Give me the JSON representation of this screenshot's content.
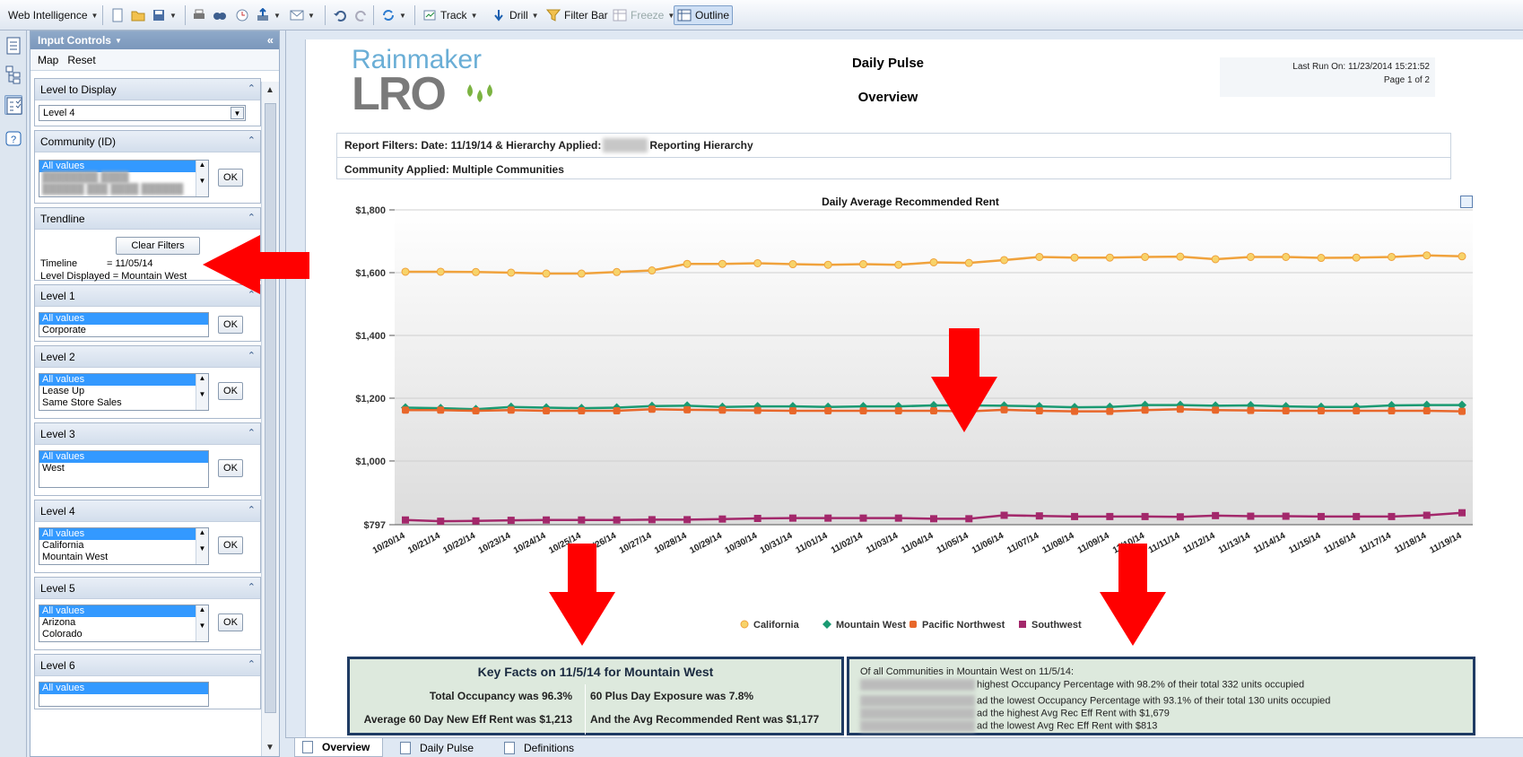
{
  "toolbar": {
    "app_menu": "Web Intelligence",
    "track": "Track",
    "drill": "Drill",
    "filter_bar": "Filter Bar",
    "freeze": "Freeze",
    "outline": "Outline"
  },
  "panel": {
    "title": "Input Controls",
    "map": "Map",
    "reset": "Reset",
    "level_to_display": {
      "title": "Level to Display",
      "value": "Level 4"
    },
    "community": {
      "title": "Community (ID)",
      "items": [
        "All values"
      ],
      "ok": "OK"
    },
    "trendline": {
      "title": "Trendline",
      "clear": "Clear Filters",
      "timeline_label": "Timeline",
      "timeline_value": "= 11/05/14",
      "level_displayed": "Level Displayed = Mountain West"
    },
    "level1": {
      "title": "Level 1",
      "items": [
        "All values",
        "Corporate"
      ],
      "ok": "OK"
    },
    "level2": {
      "title": "Level 2",
      "items": [
        "All values",
        "Lease Up",
        "Same Store Sales"
      ],
      "ok": "OK"
    },
    "level3": {
      "title": "Level 3",
      "items": [
        "All values",
        "West"
      ],
      "ok": "OK"
    },
    "level4": {
      "title": "Level 4",
      "items": [
        "All values",
        "California",
        "Mountain West"
      ],
      "ok": "OK"
    },
    "level5": {
      "title": "Level 5",
      "items": [
        "All values",
        "Arizona",
        "Colorado"
      ],
      "ok": "OK"
    },
    "level6": {
      "title": "Level 6",
      "items": [
        "All values"
      ]
    }
  },
  "report": {
    "logo_top": "Rainmaker",
    "logo_bottom": "LRO",
    "title": "Daily Pulse",
    "subtitle": "Overview",
    "last_run": "Last Run On: 11/23/2014 15:21:52",
    "page": "Page 1 of 2",
    "filter_prefix": "Report Filters: Date: 11/19/14 & Hierarchy Applied:",
    "filter_suffix": "Reporting Hierarchy",
    "community_applied": "Community Applied: Multiple Communities"
  },
  "chart_data": {
    "type": "line",
    "title": "Daily Average Recommended Rent",
    "categories": [
      "10/20/14",
      "10/21/14",
      "10/22/14",
      "10/23/14",
      "10/24/14",
      "10/25/14",
      "10/26/14",
      "10/27/14",
      "10/28/14",
      "10/29/14",
      "10/30/14",
      "10/31/14",
      "11/01/14",
      "11/02/14",
      "11/03/14",
      "11/04/14",
      "11/05/14",
      "11/06/14",
      "11/07/14",
      "11/08/14",
      "11/09/14",
      "11/10/14",
      "11/11/14",
      "11/12/14",
      "11/13/14",
      "11/14/14",
      "11/15/14",
      "11/16/14",
      "11/17/14",
      "11/18/14",
      "11/19/14"
    ],
    "y_ticks": [
      "$1,800",
      "$1,600",
      "$1,400",
      "$1,200",
      "$1,000",
      "$797"
    ],
    "ylim": [
      797,
      1800
    ],
    "series": [
      {
        "name": "California",
        "color": "#f0a23c",
        "marker": "circle",
        "values": [
          1603,
          1603,
          1602,
          1600,
          1597,
          1597,
          1602,
          1607,
          1628,
          1628,
          1630,
          1627,
          1625,
          1627,
          1625,
          1633,
          1631,
          1640,
          1650,
          1648,
          1648,
          1650,
          1651,
          1643,
          1650,
          1650,
          1647,
          1648,
          1650,
          1655,
          1652
        ]
      },
      {
        "name": "Mountain West",
        "color": "#1a9a72",
        "marker": "diamond",
        "values": [
          1170,
          1168,
          1165,
          1172,
          1170,
          1168,
          1170,
          1175,
          1176,
          1172,
          1174,
          1174,
          1172,
          1174,
          1174,
          1177,
          1177,
          1176,
          1174,
          1171,
          1172,
          1178,
          1178,
          1176,
          1177,
          1174,
          1172,
          1172,
          1177,
          1178,
          1178
        ]
      },
      {
        "name": "Pacific Northwest",
        "color": "#e8672a",
        "marker": "square-round",
        "values": [
          1162,
          1162,
          1160,
          1162,
          1160,
          1160,
          1160,
          1165,
          1163,
          1162,
          1161,
          1160,
          1160,
          1160,
          1160,
          1160,
          1158,
          1163,
          1160,
          1158,
          1158,
          1162,
          1165,
          1162,
          1161,
          1160,
          1160,
          1160,
          1160,
          1160,
          1158
        ]
      },
      {
        "name": "Southwest",
        "color": "#a3286b",
        "marker": "square",
        "values": [
          812,
          808,
          809,
          811,
          812,
          812,
          812,
          813,
          813,
          815,
          817,
          818,
          818,
          818,
          818,
          816,
          816,
          827,
          825,
          823,
          823,
          823,
          822,
          826,
          824,
          824,
          823,
          823,
          823,
          827,
          835
        ]
      }
    ]
  },
  "key_facts": {
    "title": "Key Facts on 11/5/14 for Mountain West",
    "occupancy": "Total Occupancy was 96.3%",
    "exposure": "60 Plus Day Exposure was 7.8%",
    "new_rent": "Average 60 Day New Eff Rent was $1,213",
    "rec_rent": "And the Avg Recommended Rent was $1,177"
  },
  "communities": {
    "heading": "Of all Communities in Mountain West on 11/5/14:",
    "line1": "highest Occupancy Percentage with 98.2% of their  total 332 units occupied",
    "line2": "ad the lowest Occupancy Percentage with 93.1% of their total 130  units occupied",
    "line3": "ad the highest Avg Rec Eff Rent with $1,679",
    "line4": "ad the lowest Avg Rec Eff Rent with $813"
  },
  "tabs": [
    "Overview",
    "Daily Pulse",
    "Definitions"
  ]
}
